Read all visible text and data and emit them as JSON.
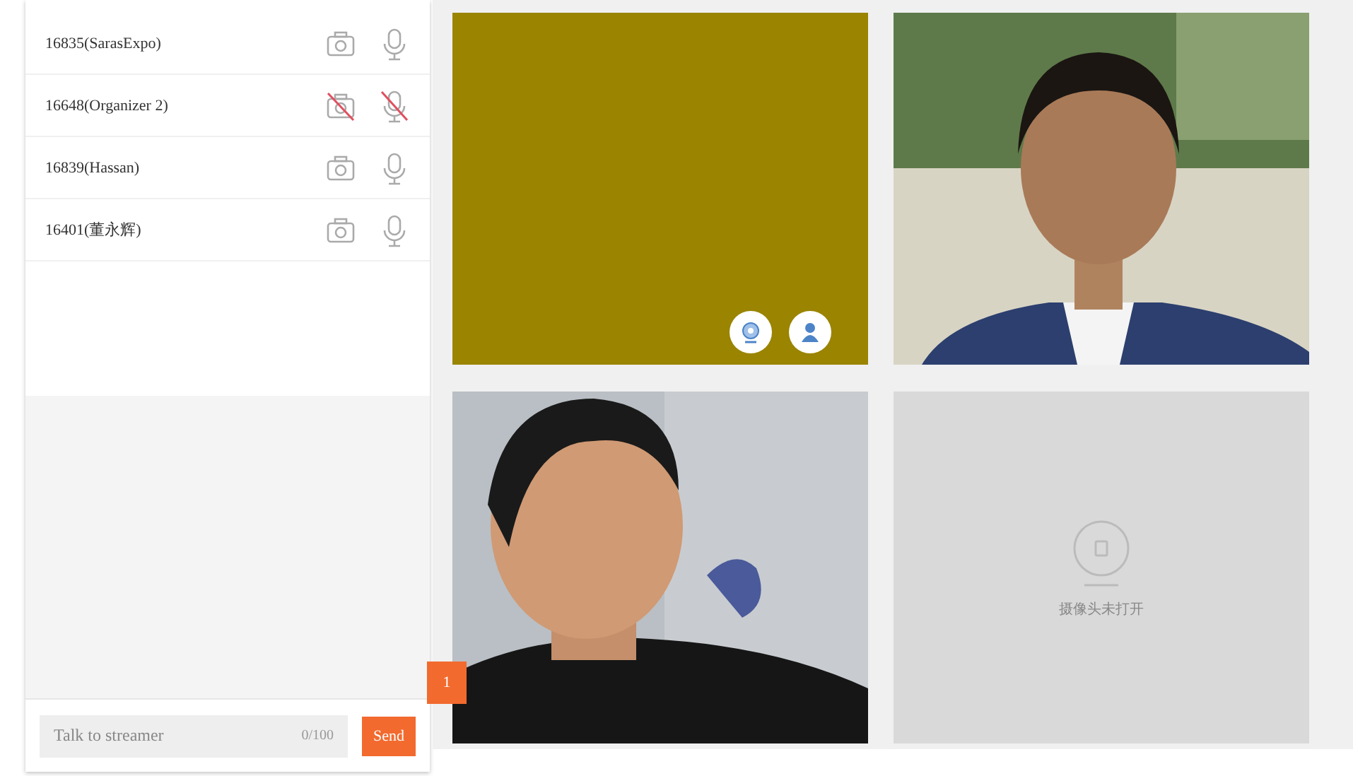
{
  "participants": [
    {
      "name": "16835(SarasExpo)",
      "camera_on": true,
      "mic_on": true
    },
    {
      "name": "16648(Organizer 2)",
      "camera_on": false,
      "mic_on": false
    },
    {
      "name": "16839(Hassan)",
      "camera_on": true,
      "mic_on": true
    },
    {
      "name": "16401(董永辉)",
      "camera_on": true,
      "mic_on": true
    }
  ],
  "chat": {
    "placeholder": "Talk to streamer",
    "counter": "0/100",
    "send": "Send"
  },
  "side_tab": "1",
  "tiles": [
    {
      "kind": "blank"
    },
    {
      "kind": "picture"
    },
    {
      "kind": "picture"
    },
    {
      "kind": "off",
      "caption": "摄像头未打开"
    }
  ]
}
